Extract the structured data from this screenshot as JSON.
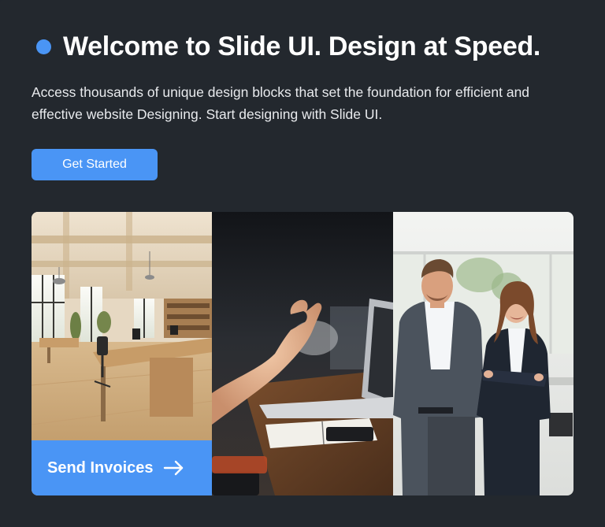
{
  "hero": {
    "title": "Welcome to Slide UI. Design at Speed.",
    "description": "Access thousands of unique design blocks that set the foundation for efficient and effective website Designing. Start designing with Slide UI.",
    "cta_label": "Get Started"
  },
  "gallery": {
    "images": [
      {
        "subject": "sunlit open-plan office interior with wooden desks"
      },
      {
        "subject": "hand gesturing over a desk with laptop and notebook"
      },
      {
        "subject": "smiling businessman and businesswoman standing in an office"
      }
    ],
    "overlay_card": {
      "label": "Send Invoices",
      "icon": "arrow-right-icon"
    }
  },
  "colors": {
    "background": "#23282e",
    "accent": "#4a95f5",
    "text": "#ffffff"
  }
}
